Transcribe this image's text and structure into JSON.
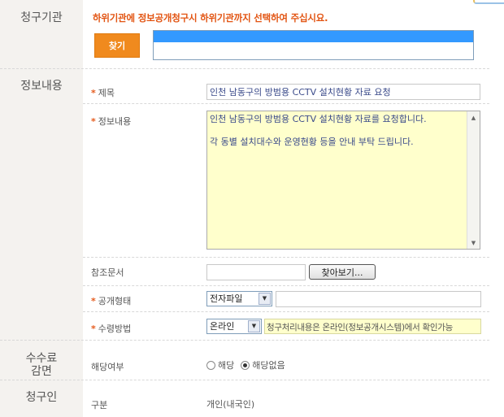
{
  "sections": {
    "agency": "청구기관",
    "info": "정보내용",
    "fee": "수수료\n감면",
    "requester": "청구인"
  },
  "agency": {
    "notice": "하위기관에 정보공개청구시 하위기관까지 선택하여 주십시요.",
    "find_button": "찾기",
    "selected_agency": ""
  },
  "form": {
    "required_mark": "*",
    "title_label": "제목",
    "title_value": "인천 남동구의 방범용 CCTV 설치현황 자료 요청",
    "content_label": "정보내용",
    "content_paragraphs": [
      "인천 남동구의 방범용 CCTV 설치현황 자료를 요청합니다.",
      "각 동별 설치대수와 운영현황 등을 안내 부탁 드립니다."
    ],
    "reference_label": "참조문서",
    "reference_value": "",
    "browse_button": "찾아보기...",
    "disclosure_label": "공개형태",
    "disclosure_value": "전자파일",
    "disclosure_extra": "",
    "receipt_label": "수령방법",
    "receipt_value": "온라인",
    "receipt_hint": "청구처리내용은 온라인(정보공개시스템)에서 확인가능"
  },
  "fee": {
    "applicable_label": "해당여부",
    "options": [
      "해당",
      "해당없음"
    ],
    "selected": "해당없음"
  },
  "requester": {
    "type_label": "구분",
    "type_value": "개인(내국인)"
  },
  "icons": {
    "scroll_up": "triangle-up-icon",
    "scroll_down": "triangle-down-icon",
    "dropdown": "chevron-down-icon"
  }
}
